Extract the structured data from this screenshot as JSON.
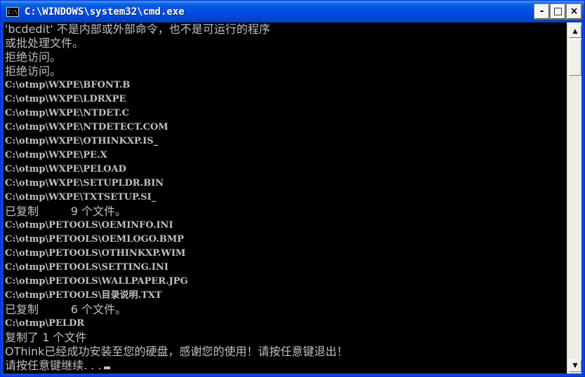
{
  "window": {
    "title": "C:\\WINDOWS\\system32\\cmd.exe",
    "icon": "cmd-icon",
    "minimize_label": "-",
    "maximize_label": "□",
    "close_label": "×"
  },
  "console": {
    "lines": [
      {
        "text": "'bcdedit' 不是内部或外部命令，也不是可运行的程序",
        "style": "cjk"
      },
      {
        "text": "或批处理文件。",
        "style": "cjk"
      },
      {
        "text": "拒绝访问。",
        "style": "cjk"
      },
      {
        "text": "拒绝访问。",
        "style": "cjk"
      },
      {
        "text": "C:\\otmp\\WXPE\\BFONT.B",
        "style": "path"
      },
      {
        "text": "C:\\otmp\\WXPE\\LDRXPE",
        "style": "path"
      },
      {
        "text": "C:\\otmp\\WXPE\\NTDET.C",
        "style": "path"
      },
      {
        "text": "C:\\otmp\\WXPE\\NTDETECT.COM",
        "style": "path"
      },
      {
        "text": "C:\\otmp\\WXPE\\OTHINKXP.IS_",
        "style": "path"
      },
      {
        "text": "C:\\otmp\\WXPE\\PE.X",
        "style": "path"
      },
      {
        "text": "C:\\otmp\\WXPE\\PELOAD",
        "style": "path"
      },
      {
        "text": "C:\\otmp\\WXPE\\SETUPLDR.BIN",
        "style": "path"
      },
      {
        "text": "C:\\otmp\\WXPE\\TXTSETUP.SI_",
        "style": "path"
      },
      {
        "text": "已复制         9 个文件。",
        "style": "cjk"
      },
      {
        "text": "C:\\otmp\\PETOOLS\\OEMINFO.INI",
        "style": "path"
      },
      {
        "text": "C:\\otmp\\PETOOLS\\OEMLOGO.BMP",
        "style": "path"
      },
      {
        "text": "C:\\otmp\\PETOOLS\\OTHINKXP.WIM",
        "style": "path"
      },
      {
        "text": "C:\\otmp\\PETOOLS\\SETTING.INI",
        "style": "path"
      },
      {
        "text": "C:\\otmp\\PETOOLS\\WALLPAPER.JPG",
        "style": "path"
      },
      {
        "text": "C:\\otmp\\PETOOLS\\目录说明.TXT",
        "style": "path"
      },
      {
        "text": "已复制         6 个文件。",
        "style": "cjk"
      },
      {
        "text": "C:\\otmp\\PELDR",
        "style": "path"
      },
      {
        "text": "复制了 1 个文件",
        "style": "cjk"
      },
      {
        "text": "OThink已经成功安装至您的硬盘，感谢您的使用！请按任意键退出！",
        "style": "cjk"
      },
      {
        "text": "请按任意键继续. . .",
        "style": "cjk",
        "cursor": true
      }
    ]
  },
  "scrollbar": {
    "up_arrow": "▲",
    "down_arrow": "▼"
  },
  "colors": {
    "titlebar": "#0050e6",
    "console_bg": "#000000",
    "console_text": "#c0c0c0"
  }
}
